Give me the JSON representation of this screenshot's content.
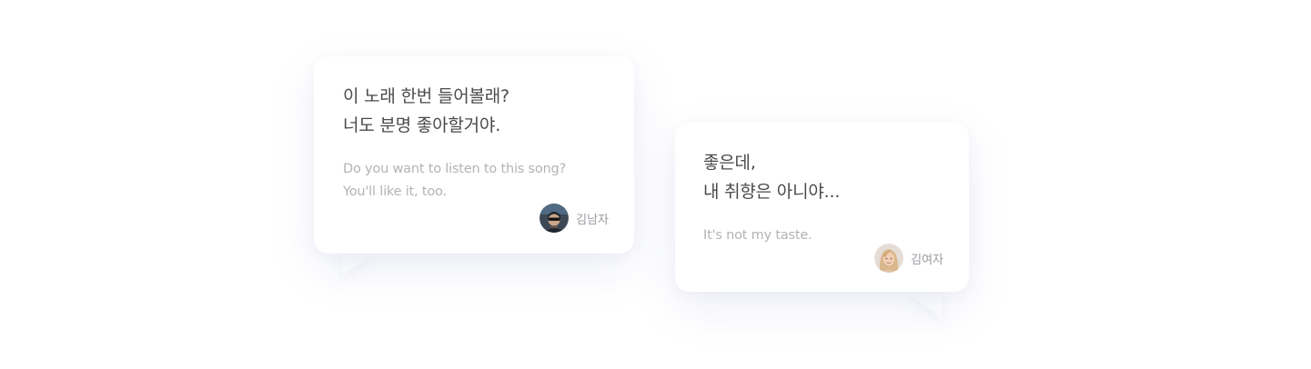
{
  "messages": [
    {
      "korean_lines": [
        "이 노래 한번 들어볼래?",
        "너도 분명 좋아할거야."
      ],
      "english_lines": [
        "Do you want to listen to this song?",
        "You'll like it, too."
      ],
      "author": "김남자",
      "avatar_icon": "man-with-sunglasses-avatar-icon"
    },
    {
      "korean_lines": [
        "좋은데,",
        "내 취향은 아니야..."
      ],
      "english_lines": [
        "It's not my taste."
      ],
      "author": "김여자",
      "avatar_icon": "blonde-woman-avatar-icon"
    }
  ],
  "colors": {
    "korean_text": "#4a4a4a",
    "english_text": "#b3b3b8",
    "author_text": "#9a9aa0",
    "bubble_background": "#ffffff"
  }
}
